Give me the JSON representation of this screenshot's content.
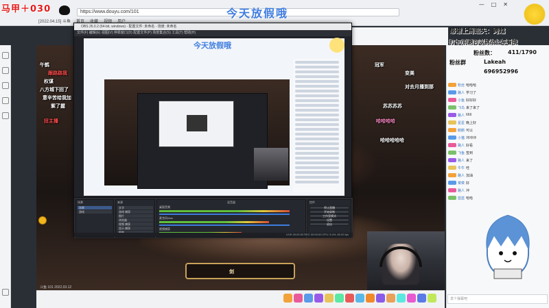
{
  "browser": {
    "url": "https://www.douyu.com/101",
    "bookmarks": [
      "[2022.04.15] 斗鱼",
      "首页",
      "收藏",
      "视频",
      "用户"
    ],
    "window_controls": [
      "—",
      "□",
      "✕"
    ]
  },
  "overlay": {
    "logo": "马甲＋030",
    "stream_title": "今天放假哦",
    "thanks_line": "感谢上周追夫：跨越",
    "line2": "打卡/别刷可以挑战上车看哦",
    "fans_label": "粉丝数：",
    "fans_count": "411/1790",
    "group_line": "粉丝群",
    "group_name": "Lakeah",
    "group_number": "696952996"
  },
  "obs": {
    "title": "OBS 26.0.2 (64-bit, windows) - 配置文件: 未命名 - 场景: 未命名",
    "menu": "文件(F)  编辑(E)  视图(V)  停靠窗口(D)  配置文件(P)  场景集合(S)  工具(T)  帮助(H)",
    "preview_title": "今天放假哦",
    "docks": {
      "scenes_title": "场景",
      "sources_title": "来源",
      "mixer_title": "混音器",
      "controls_title": "控件",
      "scenes": [
        "场景",
        "游戏"
      ],
      "sources": [
        "文字",
        "游戏 捕获",
        "图片",
        "浏览器",
        "视频 捕获",
        "显示 捕获",
        "图像"
      ],
      "mixer_channels": [
        "桌面音频",
        "麦克风/Aux",
        "视频捕获"
      ],
      "controls": [
        "停止直播",
        "开始录制",
        "工作室模式",
        "设置",
        "退出"
      ]
    },
    "status": "LIVE 00:00:00   REC 00:00:00   CPU: 5.4%, 60.00 fps"
  },
  "danmaku": [
    {
      "text": "午鹤",
      "color": "white"
    },
    {
      "text": "跟路路我",
      "color": "red"
    },
    {
      "text": "权谋",
      "color": "white"
    },
    {
      "text": "八方城下回了",
      "color": "white"
    },
    {
      "text": "意辛苦给我加",
      "color": "white"
    },
    {
      "text": "紫了握",
      "color": "white"
    },
    {
      "text": "扭主播",
      "color": "red"
    },
    {
      "text": "哈哈哈哈",
      "color": "pink"
    },
    {
      "text": "变美",
      "color": "white"
    },
    {
      "text": "对去月播到那",
      "color": "white"
    },
    {
      "text": "哈哈哈哈哈",
      "color": "white"
    },
    {
      "text": "苏苏苏苏",
      "color": "white"
    },
    {
      "text": "冠军",
      "color": "white"
    }
  ],
  "chat": {
    "messages": [
      {
        "name": "粉丝",
        "msg": "哈哈哈"
      },
      {
        "name": "路人",
        "msg": "学习了"
      },
      {
        "name": "小鱼",
        "msg": "好好好"
      },
      {
        "name": "飞鸟",
        "msg": "来了来了"
      },
      {
        "name": "路人",
        "msg": "666"
      },
      {
        "name": "星星",
        "msg": "晚上好"
      },
      {
        "name": "鹅鹅",
        "msg": "可以"
      },
      {
        "name": "小猫",
        "msg": "冲冲冲"
      },
      {
        "name": "路人",
        "msg": "好看"
      },
      {
        "name": "飞鱼",
        "msg": "签到"
      },
      {
        "name": "路人",
        "msg": "来了"
      },
      {
        "name": "牛牛",
        "msg": "哇"
      },
      {
        "name": "路人",
        "msg": "加油"
      },
      {
        "name": "菜菜",
        "msg": "好"
      },
      {
        "name": "路人",
        "msg": "冲"
      },
      {
        "name": "蓝蓝",
        "msg": "哈哈"
      }
    ],
    "input_placeholder": "发个弹幕吧"
  },
  "game_hud": {
    "text": "剑"
  },
  "timecode": "斗鱼 101  2022.03.12",
  "footer_gifts": [
    {
      "color": "#f2a23a",
      "label": "礼物"
    },
    {
      "color": "#e85a9a",
      "label": "礼物"
    },
    {
      "color": "#5a9ae8",
      "label": "礼物"
    },
    {
      "color": "#9a5ae8",
      "label": "礼物"
    },
    {
      "color": "#e8c35a",
      "label": "礼物"
    },
    {
      "color": "#5ae8a3",
      "label": "礼物"
    },
    {
      "color": "#e85a5a",
      "label": "礼物"
    },
    {
      "color": "#5ab8e8",
      "label": "礼物"
    },
    {
      "color": "#f08a2a",
      "label": "礼物"
    },
    {
      "color": "#8a5ae8",
      "label": "礼物"
    },
    {
      "color": "#e8a05a",
      "label": "礼物"
    },
    {
      "color": "#5ae8e0",
      "label": "礼物"
    },
    {
      "color": "#e85ad0",
      "label": "礼物"
    },
    {
      "color": "#5a7ae8",
      "label": "礼物"
    },
    {
      "color": "#c0e85a",
      "label": "礼物"
    }
  ],
  "colors": {
    "accent_blue": "#3f7de0",
    "logo_red": "#e21b1b",
    "danmaku_red": "#ff4d4d",
    "danmaku_pink": "#ff8cc6"
  }
}
